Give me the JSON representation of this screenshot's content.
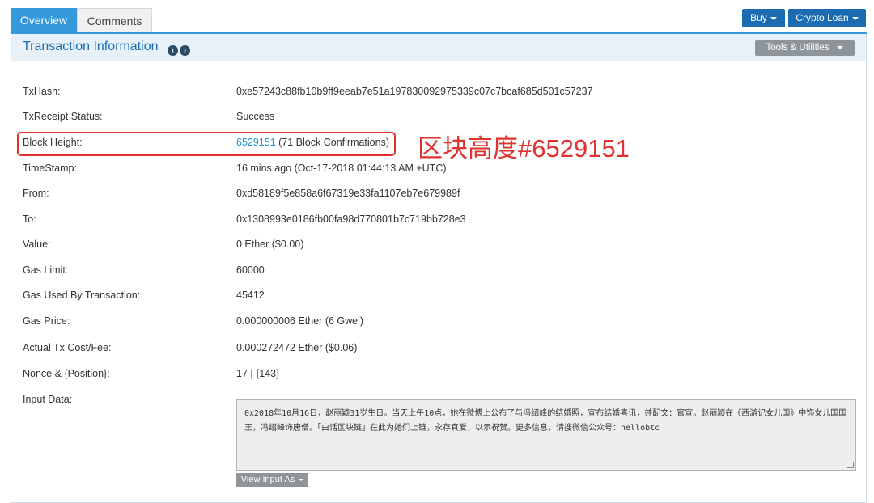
{
  "tabs": [
    {
      "label": "Overview",
      "active": true
    },
    {
      "label": "Comments",
      "active": false
    }
  ],
  "top_buttons": {
    "buy": "Buy",
    "crypto_loan": "Crypto Loan"
  },
  "panel": {
    "title": "Transaction Information",
    "nav_prev_icon": "chevron-left-circle-icon",
    "nav_next_icon": "chevron-right-circle-icon",
    "tools_button": "Tools & Utilities"
  },
  "fields": {
    "txhash": {
      "label": "TxHash:",
      "value": "0xe57243c88fb10b9ff9eeab7e51a197830092975339c07c7bcaf685d501c57237"
    },
    "status": {
      "label": "TxReceipt Status:",
      "value": "Success"
    },
    "block": {
      "label": "Block Height:",
      "value": "6529151",
      "suffix": " (71 Block Confirmations)"
    },
    "timestamp": {
      "label": "TimeStamp:",
      "value": "16 mins ago (Oct-17-2018 01:44:13 AM +UTC)"
    },
    "from": {
      "label": "From:",
      "value": "0xd58189f5e858a6f67319e33fa1107eb7e679989f"
    },
    "to": {
      "label": "To:",
      "value": "0x1308993e0186fb00fa98d770801b7c719bb728e3"
    },
    "value": {
      "label": "Value:",
      "value": "0 Ether ($0.00)"
    },
    "gas_limit": {
      "label": "Gas Limit:",
      "value": "60000"
    },
    "gas_used": {
      "label": "Gas Used By Transaction:",
      "value": "45412"
    },
    "gas_price": {
      "label": "Gas Price:",
      "value": "0.000000006 Ether (6 Gwei)"
    },
    "fee": {
      "label": "Actual Tx Cost/Fee:",
      "value": "0.000272472 Ether ($0.06)"
    },
    "nonce": {
      "label": "Nonce & {Position}:",
      "value": "17 | {143}"
    },
    "input_data": {
      "label": "Input Data:",
      "value": "0x2018年10月16日，赵丽颖31岁生日。当天上午10点，她在微博上公布了与冯绍峰的结婚照，宣布结婚喜讯，并配文：官宣。赵丽颖在《西游记女儿国》中饰女儿国国王，冯绍峰饰唐僧。「白话区块链」在此为她们上链，永存真爱，以示祝贺。更多信息，请搜微信公众号：hellobtc",
      "view_button": "View Input As"
    }
  },
  "annotation": {
    "text": "区块高度#6529151",
    "color": "#e0322f"
  },
  "colors": {
    "accent": "#3498db",
    "button": "#1a6bb2",
    "link": "#1a95d4",
    "success": "#1e8e3e",
    "highlight": "#e0322f"
  }
}
